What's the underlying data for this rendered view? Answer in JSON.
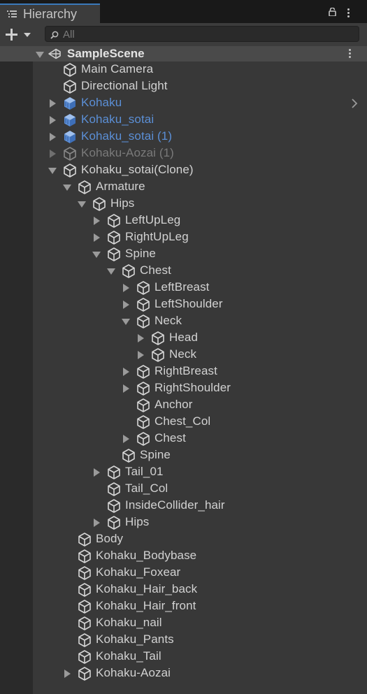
{
  "window": {
    "tab_title": "Hierarchy"
  },
  "toolbar": {
    "search_placeholder": "All"
  },
  "scene": {
    "name": "SampleScene"
  },
  "colors": {
    "prefab": "#5b8fd6",
    "disabled": "#7a7a7a",
    "tab_accent": "#3a79bb"
  },
  "rows": [
    {
      "label": "Main Camera",
      "depth": 0,
      "arrow": "none",
      "icon": "gameobject-icon",
      "state": "normal"
    },
    {
      "label": "Directional Light",
      "depth": 0,
      "arrow": "none",
      "icon": "gameobject-icon",
      "state": "normal"
    },
    {
      "label": "Kohaku",
      "depth": 0,
      "arrow": "collapsed",
      "icon": "prefab-icon",
      "state": "prefab",
      "chevron": true
    },
    {
      "label": "Kohaku_sotai",
      "depth": 0,
      "arrow": "collapsed",
      "icon": "prefab-icon",
      "state": "prefab"
    },
    {
      "label": "Kohaku_sotai (1)",
      "depth": 0,
      "arrow": "collapsed",
      "icon": "prefab-icon",
      "state": "prefab"
    },
    {
      "label": "Kohaku-Aozai (1)",
      "depth": 0,
      "arrow": "collapsed",
      "icon": "gameobject-icon",
      "state": "disabled"
    },
    {
      "label": "Kohaku_sotai(Clone)",
      "depth": 0,
      "arrow": "expanded",
      "icon": "gameobject-icon",
      "state": "normal"
    },
    {
      "label": "Armature",
      "depth": 1,
      "arrow": "expanded",
      "icon": "gameobject-icon",
      "state": "normal"
    },
    {
      "label": "Hips",
      "depth": 2,
      "arrow": "expanded",
      "icon": "gameobject-icon",
      "state": "normal"
    },
    {
      "label": "LeftUpLeg",
      "depth": 3,
      "arrow": "collapsed",
      "icon": "gameobject-icon",
      "state": "normal"
    },
    {
      "label": "RightUpLeg",
      "depth": 3,
      "arrow": "collapsed",
      "icon": "gameobject-icon",
      "state": "normal"
    },
    {
      "label": "Spine",
      "depth": 3,
      "arrow": "expanded",
      "icon": "gameobject-icon",
      "state": "normal"
    },
    {
      "label": "Chest",
      "depth": 4,
      "arrow": "expanded",
      "icon": "gameobject-icon",
      "state": "normal"
    },
    {
      "label": "LeftBreast",
      "depth": 5,
      "arrow": "collapsed",
      "icon": "gameobject-icon",
      "state": "normal"
    },
    {
      "label": "LeftShoulder",
      "depth": 5,
      "arrow": "collapsed",
      "icon": "gameobject-icon",
      "state": "normal"
    },
    {
      "label": "Neck",
      "depth": 5,
      "arrow": "expanded",
      "icon": "gameobject-icon",
      "state": "normal"
    },
    {
      "label": "Head",
      "depth": 6,
      "arrow": "collapsed",
      "icon": "gameobject-icon",
      "state": "normal"
    },
    {
      "label": "Neck",
      "depth": 6,
      "arrow": "collapsed",
      "icon": "gameobject-icon",
      "state": "normal"
    },
    {
      "label": "RightBreast",
      "depth": 5,
      "arrow": "collapsed",
      "icon": "gameobject-icon",
      "state": "normal"
    },
    {
      "label": "RightShoulder",
      "depth": 5,
      "arrow": "collapsed",
      "icon": "gameobject-icon",
      "state": "normal"
    },
    {
      "label": "Anchor",
      "depth": 5,
      "arrow": "none",
      "icon": "gameobject-icon",
      "state": "normal"
    },
    {
      "label": "Chest_Col",
      "depth": 5,
      "arrow": "none",
      "icon": "gameobject-icon",
      "state": "normal"
    },
    {
      "label": "Chest",
      "depth": 5,
      "arrow": "collapsed",
      "icon": "gameobject-icon",
      "state": "normal"
    },
    {
      "label": "Spine",
      "depth": 4,
      "arrow": "none",
      "icon": "gameobject-icon",
      "state": "normal"
    },
    {
      "label": "Tail_01",
      "depth": 3,
      "arrow": "collapsed",
      "icon": "gameobject-icon",
      "state": "normal"
    },
    {
      "label": "Tail_Col",
      "depth": 3,
      "arrow": "none",
      "icon": "gameobject-icon",
      "state": "normal"
    },
    {
      "label": "InsideCollider_hair",
      "depth": 3,
      "arrow": "none",
      "icon": "gameobject-icon",
      "state": "normal"
    },
    {
      "label": "Hips",
      "depth": 3,
      "arrow": "collapsed",
      "icon": "gameobject-icon",
      "state": "normal"
    },
    {
      "label": "Body",
      "depth": 1,
      "arrow": "none",
      "icon": "gameobject-icon",
      "state": "normal"
    },
    {
      "label": "Kohaku_Bodybase",
      "depth": 1,
      "arrow": "none",
      "icon": "gameobject-icon",
      "state": "normal"
    },
    {
      "label": "Kohaku_Foxear",
      "depth": 1,
      "arrow": "none",
      "icon": "gameobject-icon",
      "state": "normal"
    },
    {
      "label": "Kohaku_Hair_back",
      "depth": 1,
      "arrow": "none",
      "icon": "gameobject-icon",
      "state": "normal"
    },
    {
      "label": "Kohaku_Hair_front",
      "depth": 1,
      "arrow": "none",
      "icon": "gameobject-icon",
      "state": "normal"
    },
    {
      "label": "Kohaku_nail",
      "depth": 1,
      "arrow": "none",
      "icon": "gameobject-icon",
      "state": "normal"
    },
    {
      "label": "Kohaku_Pants",
      "depth": 1,
      "arrow": "none",
      "icon": "gameobject-icon",
      "state": "normal"
    },
    {
      "label": "Kohaku_Tail",
      "depth": 1,
      "arrow": "none",
      "icon": "gameobject-icon",
      "state": "normal"
    },
    {
      "label": "Kohaku-Aozai",
      "depth": 1,
      "arrow": "collapsed",
      "icon": "gameobject-icon",
      "state": "normal"
    }
  ]
}
